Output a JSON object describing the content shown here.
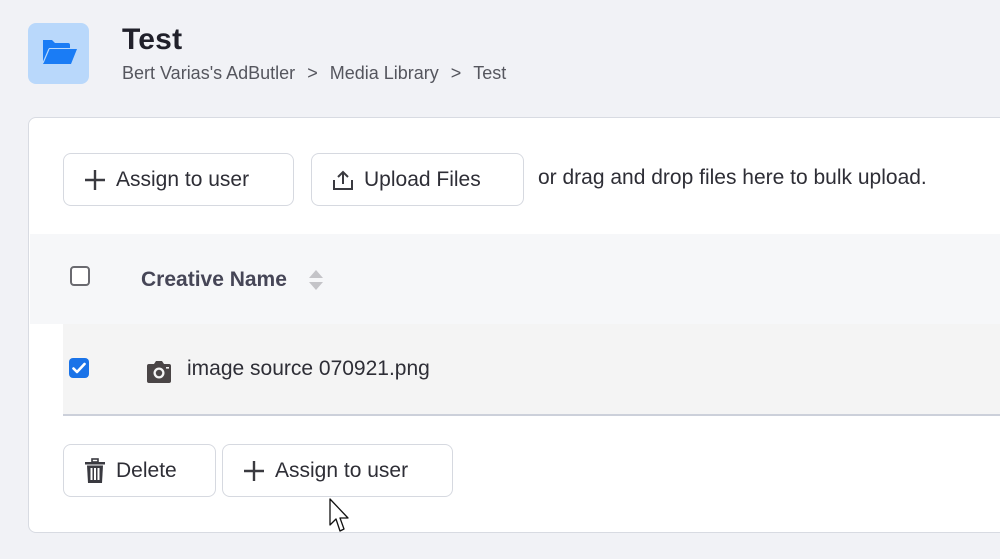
{
  "page": {
    "title": "Test",
    "breadcrumb": [
      {
        "label": "Bert Varias's AdButler"
      },
      {
        "label": "Media Library"
      },
      {
        "label": "Test"
      }
    ],
    "breadcrumb_separator": ">"
  },
  "toolbar": {
    "assign_label": "Assign to user",
    "upload_label": "Upload Files",
    "drop_hint": "or drag and drop files here to bulk upload."
  },
  "table": {
    "columns": [
      {
        "label": "Creative Name",
        "sortable": true
      }
    ],
    "rows": [
      {
        "name": "image source 070921.png",
        "type_icon": "camera-icon",
        "selected": true
      }
    ],
    "select_all_checked": false
  },
  "bulk_actions": {
    "delete_label": "Delete",
    "assign_label": "Assign to user"
  },
  "colors": {
    "accent": "#1a73e8",
    "folder_tile_bg": "#b9d8fb",
    "folder_icon": "#1a7cf5",
    "page_bg": "#f1f2f6"
  }
}
